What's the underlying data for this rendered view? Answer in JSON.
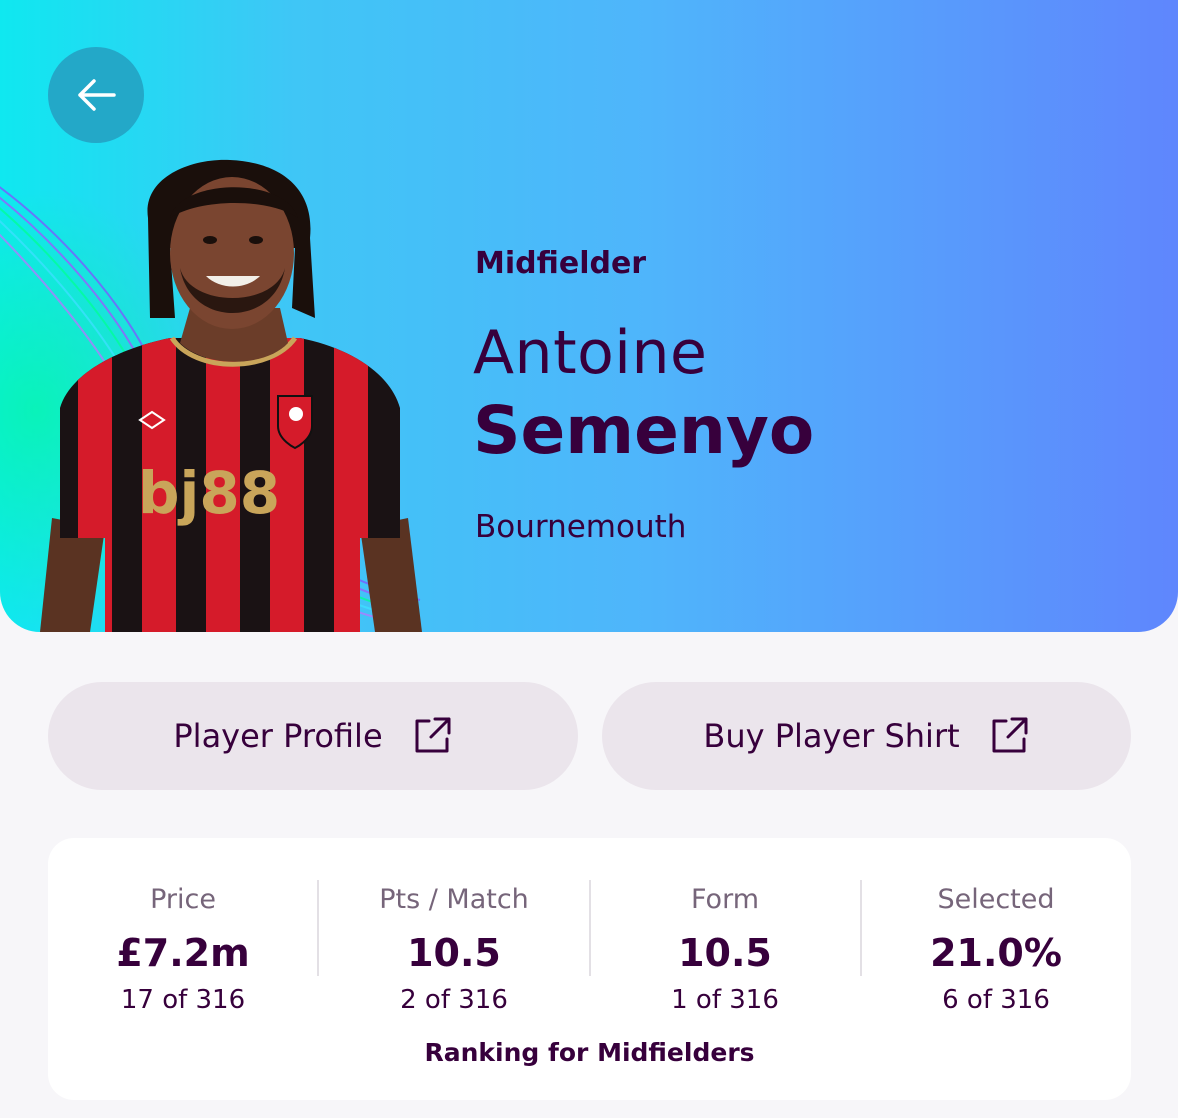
{
  "player": {
    "position": "Midfielder",
    "first_name": "Antoine",
    "last_name": "Semenyo",
    "team": "Bournemouth",
    "shirt_sponsor": "bj88"
  },
  "actions": {
    "profile_label": "Player Profile",
    "shirt_label": "Buy Player Shirt"
  },
  "stats": [
    {
      "label": "Price",
      "value": "£7.2m",
      "rank": "17 of 316"
    },
    {
      "label": "Pts / Match",
      "value": "10.5",
      "rank": "2 of 316"
    },
    {
      "label": "Form",
      "value": "10.5",
      "rank": "1 of 316"
    },
    {
      "label": "Selected",
      "value": "21.0%",
      "rank": "6 of 316"
    }
  ],
  "ranking_caption": "Ranking for Midfielders",
  "icons": {
    "back": "arrow-left-icon",
    "external": "external-link-icon"
  },
  "colors": {
    "primary_text": "#37003c",
    "hero_start": "#0fe8f0",
    "hero_end": "#5f86fd",
    "button_bg": "#ebe5ec"
  }
}
